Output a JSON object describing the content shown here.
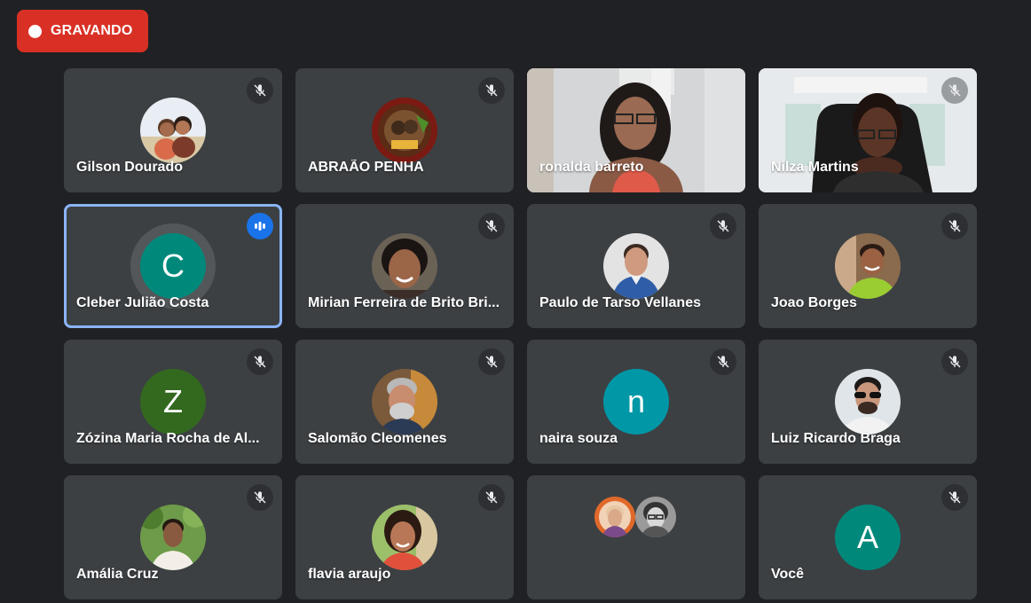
{
  "recording": {
    "label": "GRAVANDO",
    "color": "#d93025"
  },
  "colors": {
    "background": "#202124",
    "tile": "#3c4043",
    "speaking_border": "#8ab4f8",
    "speaking_badge": "#1a73e8"
  },
  "participants": [
    {
      "name": "Gilson Dourado",
      "mic": "muted",
      "avatar": "photo"
    },
    {
      "name": "ABRAÃO PENHA",
      "mic": "muted",
      "avatar": "photo"
    },
    {
      "name": "ronalda barreto",
      "mic": "unmuted",
      "avatar": "video"
    },
    {
      "name": "Nilza Martins",
      "mic": "muted",
      "avatar": "video"
    },
    {
      "name": "Cleber Julião Costa",
      "mic": "speaking",
      "avatar": "letter",
      "initial": "C",
      "avatar_color": "#00897b"
    },
    {
      "name": "Mirian Ferreira de Brito Bri...",
      "mic": "muted",
      "avatar": "photo"
    },
    {
      "name": "Paulo de Tarso Vellanes",
      "mic": "muted",
      "avatar": "photo"
    },
    {
      "name": "Joao Borges",
      "mic": "muted",
      "avatar": "photo"
    },
    {
      "name": "Zózina Maria Rocha de Al...",
      "mic": "muted",
      "avatar": "letter",
      "initial": "Z",
      "avatar_color": "#33691e"
    },
    {
      "name": "Salomão Cleomenes",
      "mic": "muted",
      "avatar": "photo"
    },
    {
      "name": "naira souza",
      "mic": "muted",
      "avatar": "letter",
      "initial": "n",
      "avatar_color": "#0097a7"
    },
    {
      "name": "Luiz Ricardo Braga",
      "mic": "muted",
      "avatar": "photo"
    },
    {
      "name": "Amália Cruz",
      "mic": "muted",
      "avatar": "photo"
    },
    {
      "name": "flavia araujo",
      "mic": "muted",
      "avatar": "photo"
    },
    {
      "name": "",
      "mic": "none",
      "avatar": "group"
    },
    {
      "name": "Você",
      "mic": "muted",
      "avatar": "letter",
      "initial": "A",
      "avatar_color": "#00897b"
    }
  ],
  "icons": {
    "muted": "mic-off-icon",
    "speaking": "audio-level-icon",
    "recording": "record-dot-icon"
  }
}
